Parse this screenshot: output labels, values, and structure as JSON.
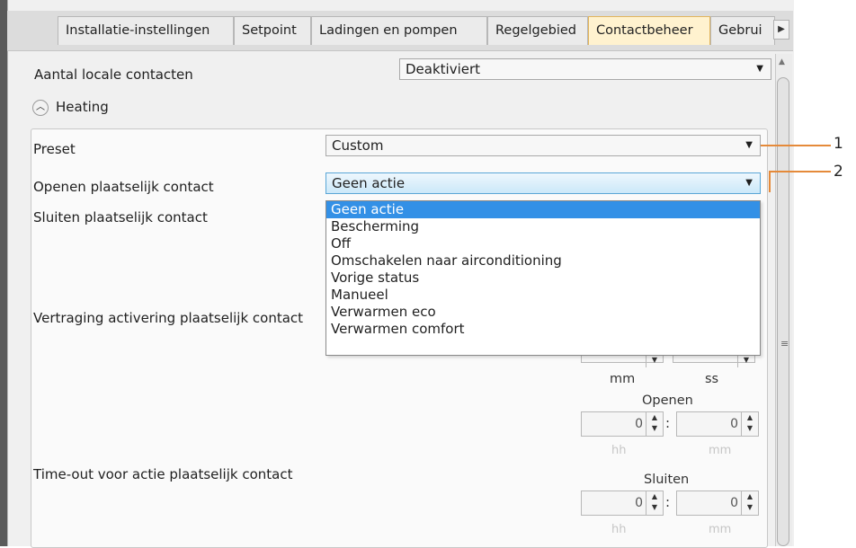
{
  "tabs": [
    {
      "label": "Installatie-instellingen",
      "active": false
    },
    {
      "label": "Setpoint",
      "active": false
    },
    {
      "label": "Ladingen en pompen",
      "active": false
    },
    {
      "label": "Regelgebied",
      "active": false
    },
    {
      "label": "Contactbeheer",
      "active": true
    },
    {
      "label": "Gebrui",
      "active": false
    }
  ],
  "tab_scroll_icon": "triangle-right-icon",
  "local_contacts": {
    "label": "Aantal locale contacten",
    "value": "Deaktiviert"
  },
  "section": {
    "title": "Heating",
    "toggle_icon": "chevron-up-icon"
  },
  "preset": {
    "label": "Preset",
    "value": "Custom"
  },
  "open_contact": {
    "label": "Openen plaatselijk contact",
    "value": "Geen actie"
  },
  "close_contact": {
    "label": "Sluiten plaatselijk contact"
  },
  "dropdown_options": [
    "Geen actie",
    "Bescherming",
    "Off",
    "Omschakelen naar airconditioning",
    "Vorige status",
    "Manueel",
    "Verwarmen eco",
    "Verwarmen comfort"
  ],
  "dropdown_selected": "Geen actie",
  "delay": {
    "label": "Vertraging activering plaatselijk contact",
    "unit1": "mm",
    "unit2": "ss"
  },
  "timeout": {
    "label": "Time-out voor actie plaatselijk contact",
    "open": {
      "title": "Openen",
      "hh": "0",
      "mm": "0",
      "unit1": "hh",
      "unit2": "mm"
    },
    "close": {
      "title": "Sluiten",
      "hh": "0",
      "mm": "0",
      "unit1": "hh",
      "unit2": "mm"
    }
  },
  "callouts": [
    "1",
    "2"
  ],
  "colors": {
    "accent": "#3390e6",
    "active_tab": "#fff2cf",
    "callout": "#e58a3a"
  }
}
